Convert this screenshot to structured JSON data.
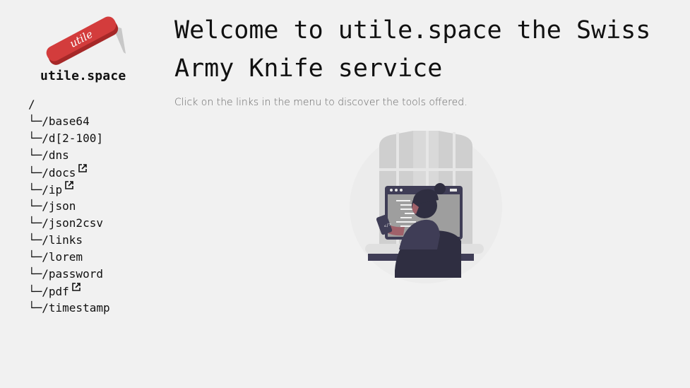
{
  "logo": {
    "knife_text": "utile",
    "brand": "utile.space"
  },
  "nav": {
    "root": "/",
    "items": [
      {
        "prefix": "└─",
        "label": "/base64",
        "external": false
      },
      {
        "prefix": "└─",
        "label": "/d[2-100]",
        "external": false
      },
      {
        "prefix": "└─",
        "label": "/dns",
        "external": false
      },
      {
        "prefix": "└─",
        "label": "/docs",
        "external": true
      },
      {
        "prefix": "└─",
        "label": "/ip",
        "external": true
      },
      {
        "prefix": "└─",
        "label": "/json",
        "external": false
      },
      {
        "prefix": "└─",
        "label": "/json2csv",
        "external": false
      },
      {
        "prefix": "└─",
        "label": "/links",
        "external": false
      },
      {
        "prefix": "└─",
        "label": "/lorem",
        "external": false
      },
      {
        "prefix": "└─",
        "label": "/password",
        "external": false
      },
      {
        "prefix": "└─",
        "label": "/pdf",
        "external": true
      },
      {
        "prefix": "└─",
        "label": "/timestamp",
        "external": false
      }
    ]
  },
  "main": {
    "title": "Welcome to utile.space the Swiss Army Knife service",
    "subtitle": "Click on the links in the menu to discover the tools offered."
  },
  "colors": {
    "background": "#f1f1f1",
    "knife_red": "#d33c3c",
    "illustration_dark": "#3f3d56",
    "illustration_grey": "#cccccc"
  },
  "icons": {
    "external_link": "external-link-icon"
  }
}
